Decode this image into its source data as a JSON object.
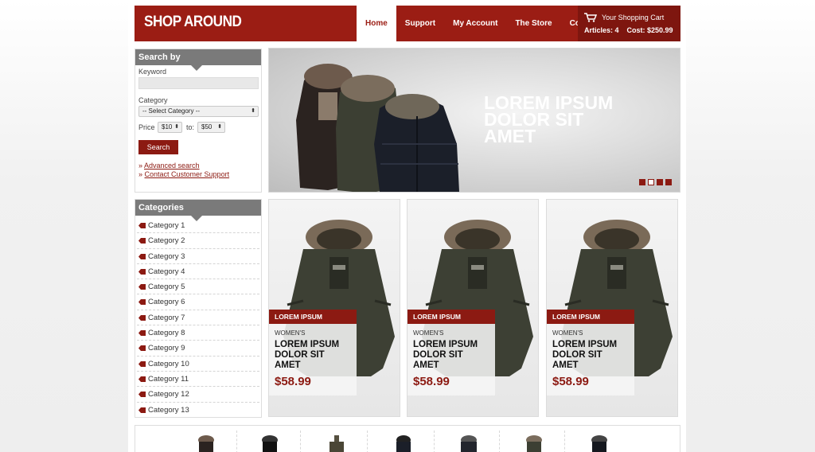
{
  "brand": {
    "logo": "SHOP AROUND",
    "accent": "#9b1d14"
  },
  "nav": [
    {
      "label": "Home",
      "active": true
    },
    {
      "label": "Support",
      "active": false
    },
    {
      "label": "My Account",
      "active": false
    },
    {
      "label": "The Store",
      "active": false
    },
    {
      "label": "Contact",
      "active": false
    }
  ],
  "cart": {
    "title": "Your Shopping Cart",
    "articles": "Articles: 4",
    "cost": "Cost: $250.99",
    "icon": "shopping-cart-icon"
  },
  "search": {
    "heading": "Search by",
    "keyword_label": "Keyword",
    "keyword_value": "",
    "category_label": "Category",
    "category_selected": "-- Select Category --",
    "price_label": "Price",
    "price_from": "$10",
    "price_to_label": "to:",
    "price_to": "$50",
    "button": "Search",
    "links": [
      "Advanced search",
      "Contact Customer Support"
    ]
  },
  "categories": {
    "heading": "Categories",
    "items": [
      "Category 1",
      "Category 2",
      "Category 3",
      "Category 4",
      "Category 5",
      "Category 6",
      "Category 7",
      "Category 8",
      "Category 9",
      "Category 10",
      "Category 11",
      "Category 12",
      "Category 13"
    ]
  },
  "hero": {
    "text": "LOREM IPSUM\nDOLOR SIT\nAMET",
    "slides": 4,
    "active_slide": 2
  },
  "products": [
    {
      "tag": "LOREM IPSUM",
      "category": "WOMEN'S",
      "name": "LOREM IPSUM\nDOLOR SIT\nAMET",
      "price": "$58.99"
    },
    {
      "tag": "LOREM IPSUM",
      "category": "WOMEN'S",
      "name": "LOREM IPSUM\nDOLOR SIT\nAMET",
      "price": "$58.99"
    },
    {
      "tag": "LOREM IPSUM",
      "category": "WOMEN'S",
      "name": "LOREM IPSUM\nDOLOR SIT\nAMET",
      "price": "$58.99"
    }
  ]
}
